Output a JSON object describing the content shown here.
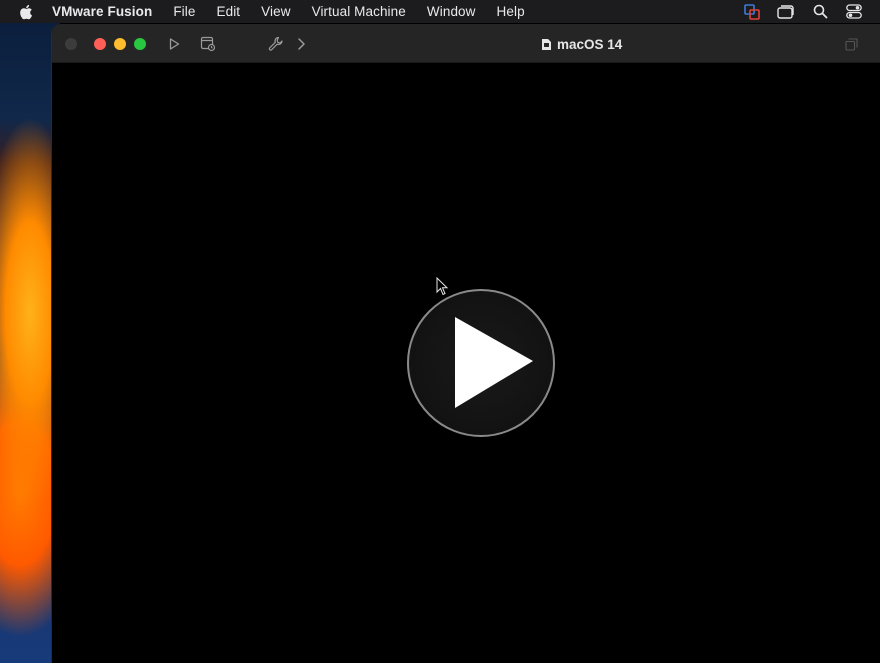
{
  "menubar": {
    "app_name": "VMware Fusion",
    "items": [
      "File",
      "Edit",
      "View",
      "Virtual Machine",
      "Window",
      "Help"
    ],
    "status_icons": [
      "vmware-icon",
      "window-switch-icon",
      "search-icon",
      "control-center-icon"
    ]
  },
  "window": {
    "title": "macOS 14",
    "toolbar_icons": [
      "play-icon",
      "snapshot-icon",
      "wrench-icon",
      "chevron-right-icon",
      "resize-icon"
    ]
  },
  "vm_screen": {
    "state": "powered off",
    "overlay_icon": "play-icon"
  },
  "colors": {
    "close": "#ff5f57",
    "minimize": "#febc2e",
    "maximize": "#28c840",
    "vmware_accent": "#3d7bd9"
  }
}
